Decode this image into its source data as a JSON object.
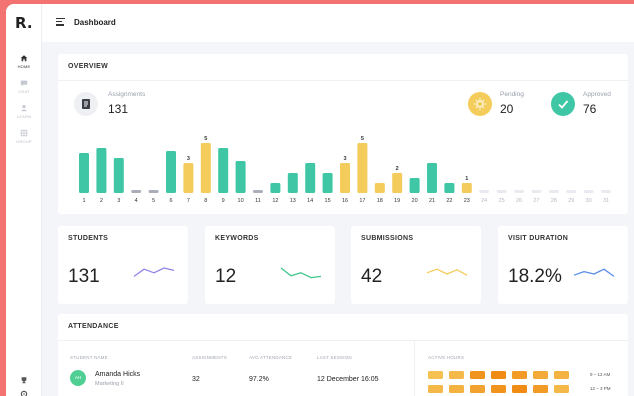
{
  "app": {
    "logo": "R.",
    "page_title": "Dashboard"
  },
  "sidebar": {
    "items": [
      {
        "label": "HOME",
        "icon": "home-icon",
        "active": true
      },
      {
        "label": "CHAT",
        "icon": "chat-icon",
        "active": false
      },
      {
        "label": "LEARN",
        "icon": "user-icon",
        "active": false
      },
      {
        "label": "GROUP",
        "icon": "group-icon",
        "active": false
      }
    ],
    "bottom_icons": [
      "trophy-icon",
      "settings-icon"
    ]
  },
  "overview": {
    "title": "OVERVIEW",
    "assignments": {
      "label": "Assignments",
      "value": "131"
    },
    "pending": {
      "label": "Pending",
      "value": "20"
    },
    "approved": {
      "label": "Approved",
      "value": "76"
    }
  },
  "chart_data": {
    "type": "bar",
    "categories": [
      "1",
      "2",
      "3",
      "4",
      "5",
      "6",
      "7",
      "8",
      "9",
      "10",
      "11",
      "12",
      "13",
      "14",
      "15",
      "16",
      "17",
      "18",
      "19",
      "20",
      "21",
      "22",
      "23",
      "24",
      "25",
      "26",
      "27",
      "28",
      "29",
      "30",
      "31"
    ],
    "values": [
      4,
      4.5,
      3.5,
      0,
      0,
      4.2,
      3,
      5,
      4.5,
      3.2,
      0,
      1,
      2,
      3,
      2,
      3,
      5,
      1,
      2,
      1.5,
      3,
      1,
      1,
      0,
      0,
      0,
      0,
      0,
      0,
      0,
      0
    ],
    "status": [
      "approved",
      "approved",
      "approved",
      "none",
      "none",
      "approved",
      "pending",
      "pending",
      "approved",
      "approved",
      "none",
      "approved",
      "approved",
      "approved",
      "approved",
      "pending",
      "pending",
      "pending",
      "pending",
      "approved",
      "approved",
      "approved",
      "pending",
      "future",
      "future",
      "future",
      "future",
      "future",
      "future",
      "future",
      "future"
    ],
    "data_labels": {
      "7": "3",
      "8": "5",
      "16": "3",
      "17": "5",
      "19": "2",
      "23": "1"
    },
    "colors": {
      "approved": "#3fc7a5",
      "pending": "#f4cc5b",
      "none": "#a9aeb8",
      "future": "#e9ebf0"
    },
    "title": "",
    "xlabel": "",
    "ylabel": ""
  },
  "metrics": [
    {
      "title": "STUDENTS",
      "value": "131",
      "color": "#8f86e8",
      "trend": [
        0.3,
        0.9,
        0.6,
        1,
        0.8
      ]
    },
    {
      "title": "KEYWORDS",
      "value": "12",
      "color": "#3fc78a",
      "trend": [
        1,
        0.35,
        0.6,
        0.2,
        0.3
      ]
    },
    {
      "title": "SUBMISSIONS",
      "value": "42",
      "color": "#f4cc5b",
      "trend": [
        0.6,
        0.9,
        0.5,
        0.85,
        0.4
      ]
    },
    {
      "title": "VISIT DURATION",
      "value": "18.2%",
      "color": "#5b8de8",
      "trend": [
        0.4,
        0.7,
        0.5,
        0.9,
        0.3
      ]
    }
  ],
  "attendance": {
    "title": "ATTENDANCE",
    "columns": [
      "STUDENT NAME",
      "ASSIGNMENTS",
      "AVG ATTENDANCE",
      "LAST SESSION"
    ],
    "active_hours_label": "ACTIVE HOURS",
    "rows": [
      {
        "initials": "AH",
        "name": "Amanda Hicks",
        "class": "Marketing II",
        "assignments": "32",
        "attendance": "97.2%",
        "last_session": "12 December 16:05"
      }
    ],
    "hours_labels": [
      "9 – 12 AM",
      "12 – 3 PM"
    ],
    "heatmap": [
      [
        0.3,
        0.4,
        0.9,
        1,
        0.8,
        0.6,
        0.5
      ],
      [
        0.4,
        0.5,
        0.7,
        0.9,
        1,
        0.8,
        0.4
      ]
    ]
  }
}
